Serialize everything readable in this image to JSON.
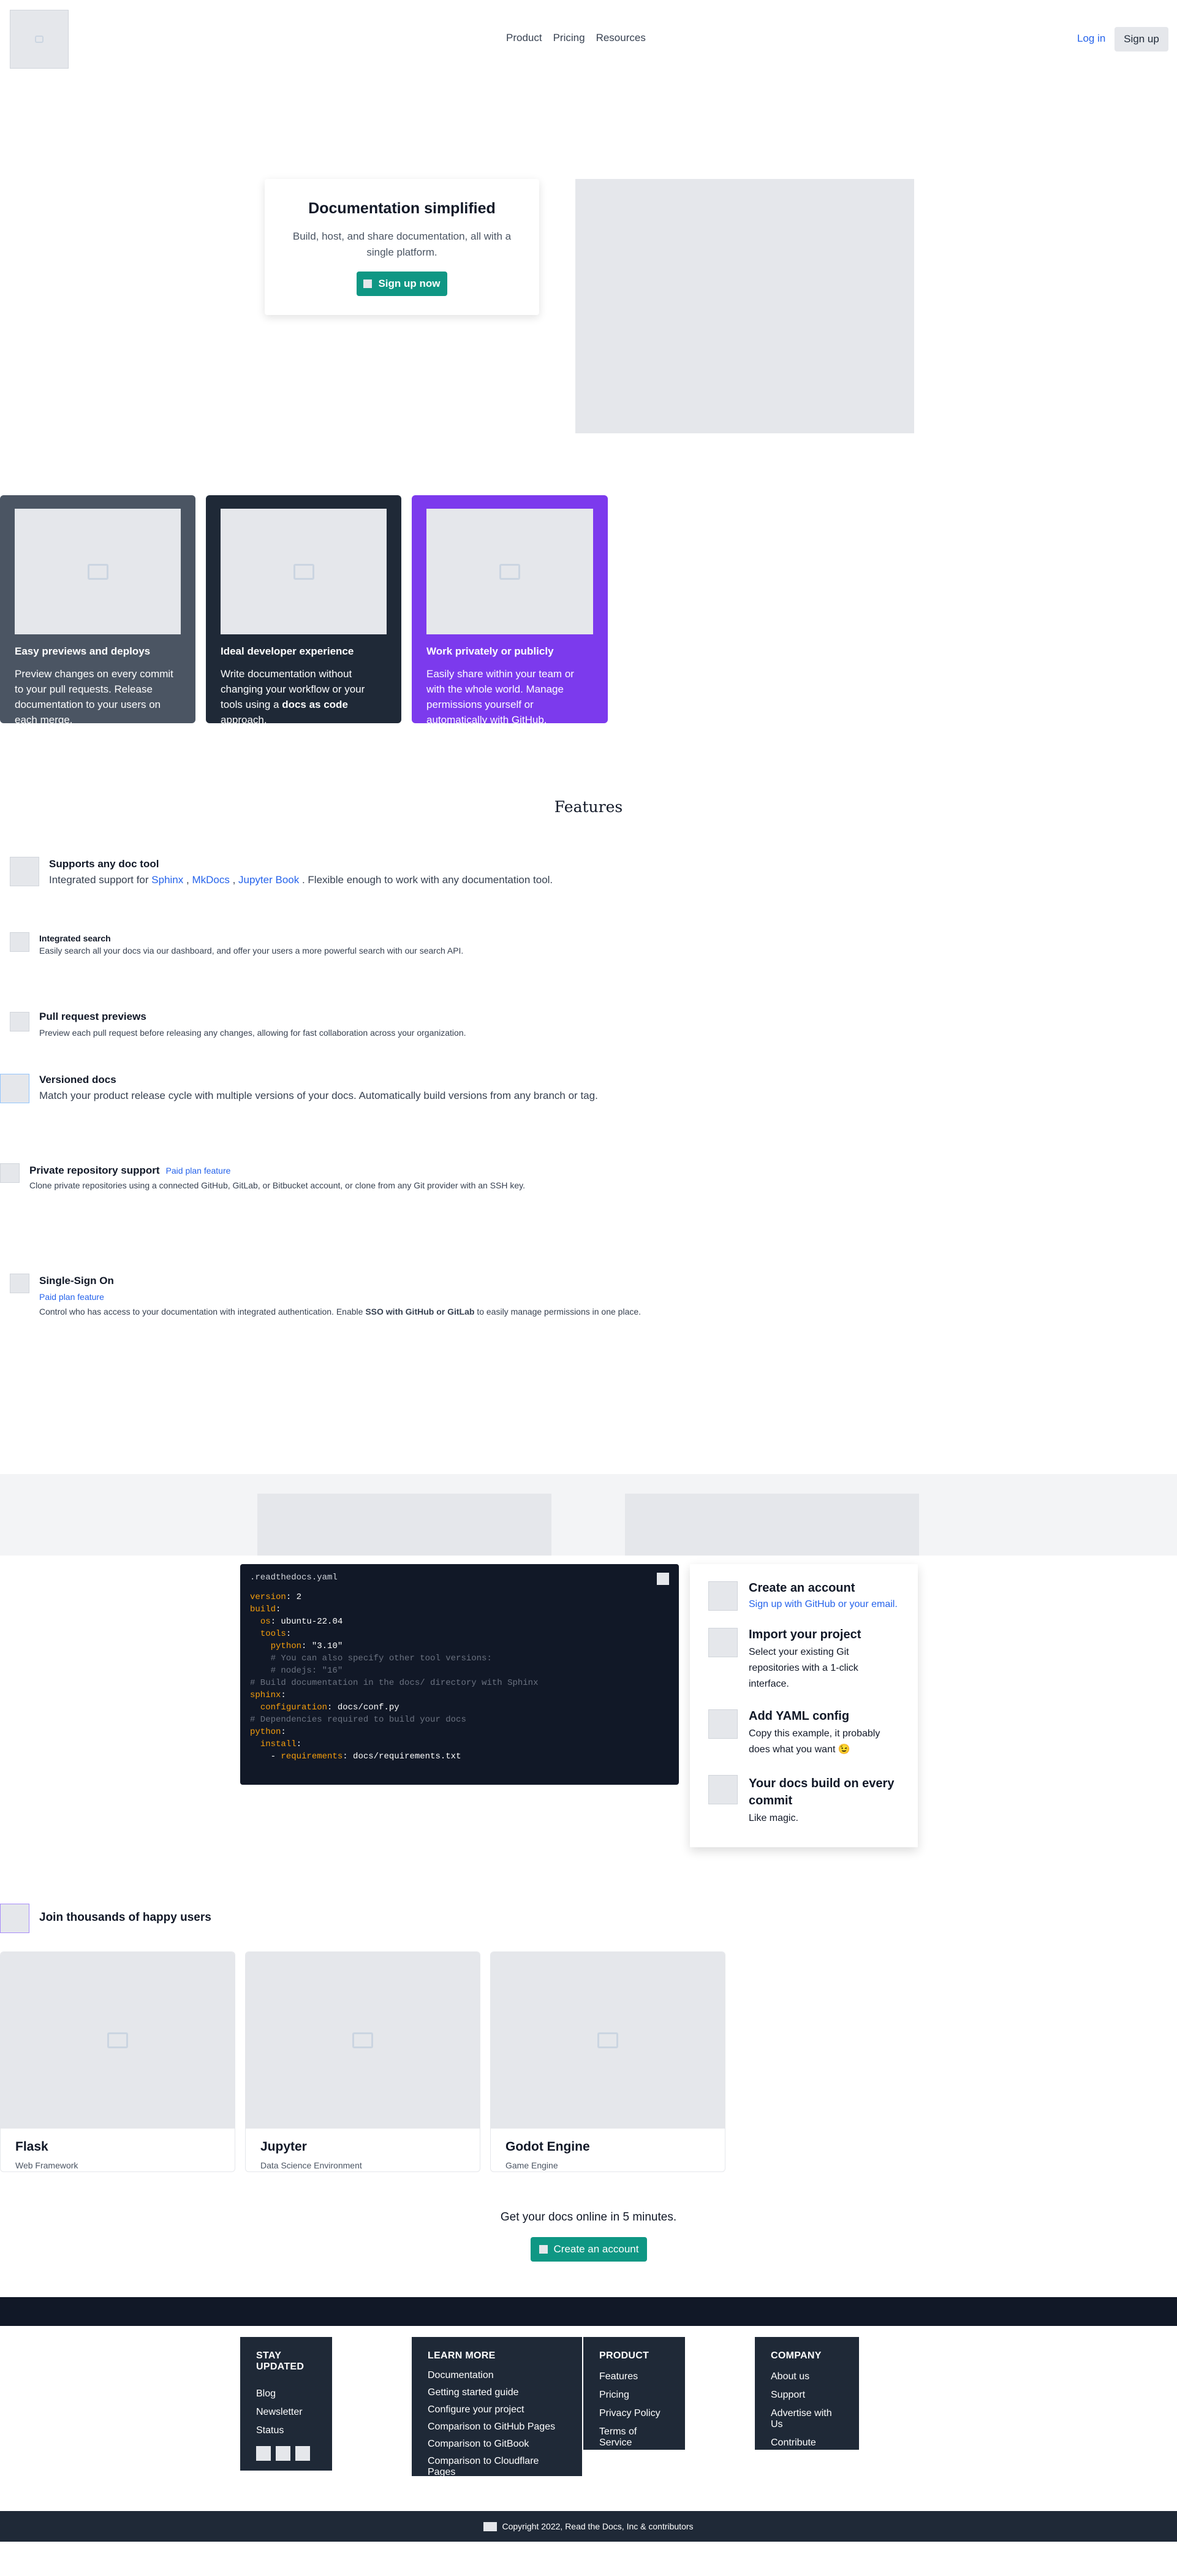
{
  "nav": {
    "links": [
      "Product",
      "Pricing",
      "Resources"
    ],
    "login": "Log in",
    "signup": "Sign up"
  },
  "hero": {
    "title": "Documentation simplified",
    "subtitle": "Build, host, and share documentation, all with a single platform.",
    "cta": "Sign up now"
  },
  "cards": [
    {
      "title": "Easy previews and deploys",
      "text": "Preview changes on every commit to your pull requests. Release documentation to your users on each merge.",
      "bg": "#4b5563"
    },
    {
      "title": "Ideal developer experience",
      "text_before": "Write documentation without changing your workflow or your tools using a ",
      "text_bold": "docs as code",
      "text_after": " approach.",
      "bg": "#1f2937"
    },
    {
      "title": "Work privately or publicly",
      "text": "Easily share within your team or with the whole world. Manage permissions yourself or automatically with GitHub.",
      "bg": "#7c3aed"
    }
  ],
  "features": {
    "heading": "Features",
    "doc_tool": {
      "title": "Supports any doc tool",
      "desc_before": "Integrated support for ",
      "sphinx": "Sphinx",
      "sep1": " , ",
      "mkdocs": "MkDocs",
      "sep2": " , ",
      "jupyter": "Jupyter Book",
      "desc_after": " . Flexible enough to work with any documentation tool."
    },
    "search": {
      "title": "Integrated search",
      "desc": "Easily search all your docs via our dashboard, and offer your users a more powerful search with our search API."
    },
    "pr": {
      "title": "Pull request previews",
      "desc": "Preview each pull request before releasing any changes, allowing for fast collaboration across your organization."
    },
    "versioned": {
      "title": "Versioned docs",
      "desc": "Match your product release cycle with multiple versions of your docs. Automatically build versions from any branch or tag."
    },
    "private": {
      "title": "Private repository support",
      "badge": "Paid plan feature",
      "desc": "Clone private repositories using a connected GitHub, GitLab, or Bitbucket account, or clone from any Git provider with an SSH key."
    },
    "sso": {
      "title": "Single-Sign On",
      "badge": "Paid plan feature",
      "desc_before": "Control who has access to your documentation with integrated authentication. Enable ",
      "desc_bold": "SSO with GitHub or GitLab",
      "desc_after": " to easily manage permissions in one place."
    }
  },
  "code": {
    "filename": ".readthedocs.yaml",
    "lines": [
      [
        [
          "k",
          "version"
        ],
        [
          "s",
          ": 2"
        ]
      ],
      [
        [
          "k",
          "build"
        ],
        [
          "s",
          ":"
        ]
      ],
      [
        [
          "s",
          "  "
        ],
        [
          "k",
          "os"
        ],
        [
          "s",
          ": ubuntu-22.04"
        ]
      ],
      [
        [
          "s",
          "  "
        ],
        [
          "k",
          "tools"
        ],
        [
          "s",
          ":"
        ]
      ],
      [
        [
          "s",
          "    "
        ],
        [
          "k",
          "python"
        ],
        [
          "s",
          ": \"3.10\""
        ]
      ],
      [
        [
          "c",
          "    # You can also specify other tool versions:"
        ]
      ],
      [
        [
          "c",
          "    # nodejs: \"16\""
        ]
      ],
      [
        [
          "c",
          "# Build documentation in the docs/ directory with Sphinx"
        ]
      ],
      [
        [
          "k",
          "sphinx"
        ],
        [
          "s",
          ":"
        ]
      ],
      [
        [
          "s",
          "  "
        ],
        [
          "k",
          "configuration"
        ],
        [
          "s",
          ": docs/conf.py"
        ]
      ],
      [
        [
          "c",
          "# Dependencies required to build your docs"
        ]
      ],
      [
        [
          "k",
          "python"
        ],
        [
          "s",
          ":"
        ]
      ],
      [
        [
          "s",
          "  "
        ],
        [
          "k",
          "install"
        ],
        [
          "s",
          ":"
        ]
      ],
      [
        [
          "s",
          "    - "
        ],
        [
          "k",
          "requirements"
        ],
        [
          "s",
          ": docs/requirements.txt"
        ]
      ]
    ]
  },
  "steps": [
    {
      "title": "Create an account",
      "desc": "Sign up with GitHub or your email.",
      "link": true
    },
    {
      "title": "Import your project",
      "desc": "Select your existing Git repositories with a 1-click interface."
    },
    {
      "title": "Add YAML config",
      "desc": "Copy this example, it probably does what you want 😉"
    },
    {
      "title": "Your docs build on every commit",
      "desc": "Like magic."
    }
  ],
  "users": {
    "heading": "Join thousands of happy users",
    "items": [
      {
        "name": "Flask",
        "type": "Web Framework"
      },
      {
        "name": "Jupyter",
        "type": "Data Science Environment"
      },
      {
        "name": "Godot Engine",
        "type": "Game Engine"
      }
    ]
  },
  "cta": {
    "text": "Get your docs online in 5 minutes.",
    "button": "Create an account"
  },
  "footer": {
    "stay": {
      "title": "STAY UPDATED",
      "items": [
        "Blog",
        "Newsletter",
        "Status"
      ]
    },
    "learn": {
      "title": "LEARN MORE",
      "items": [
        "Documentation",
        "Getting started guide",
        "Configure your project",
        "Comparison to GitHub Pages",
        "Comparison to GitBook",
        "Comparison to Cloudflare Pages"
      ]
    },
    "product": {
      "title": "PRODUCT",
      "items": [
        "Features",
        "Pricing",
        "Privacy Policy",
        "Terms of Service"
      ]
    },
    "company": {
      "title": "COMPANY",
      "items": [
        "About us",
        "Support",
        "Advertise with Us",
        "Contribute"
      ]
    },
    "copyright": "Copyright 2022, Read the Docs, Inc & contributors"
  },
  "colors": {
    "teal": "#0f9784",
    "link": "#2563eb",
    "dark": "#1f2937",
    "navy": "#111827",
    "purple": "#7c3aed"
  }
}
